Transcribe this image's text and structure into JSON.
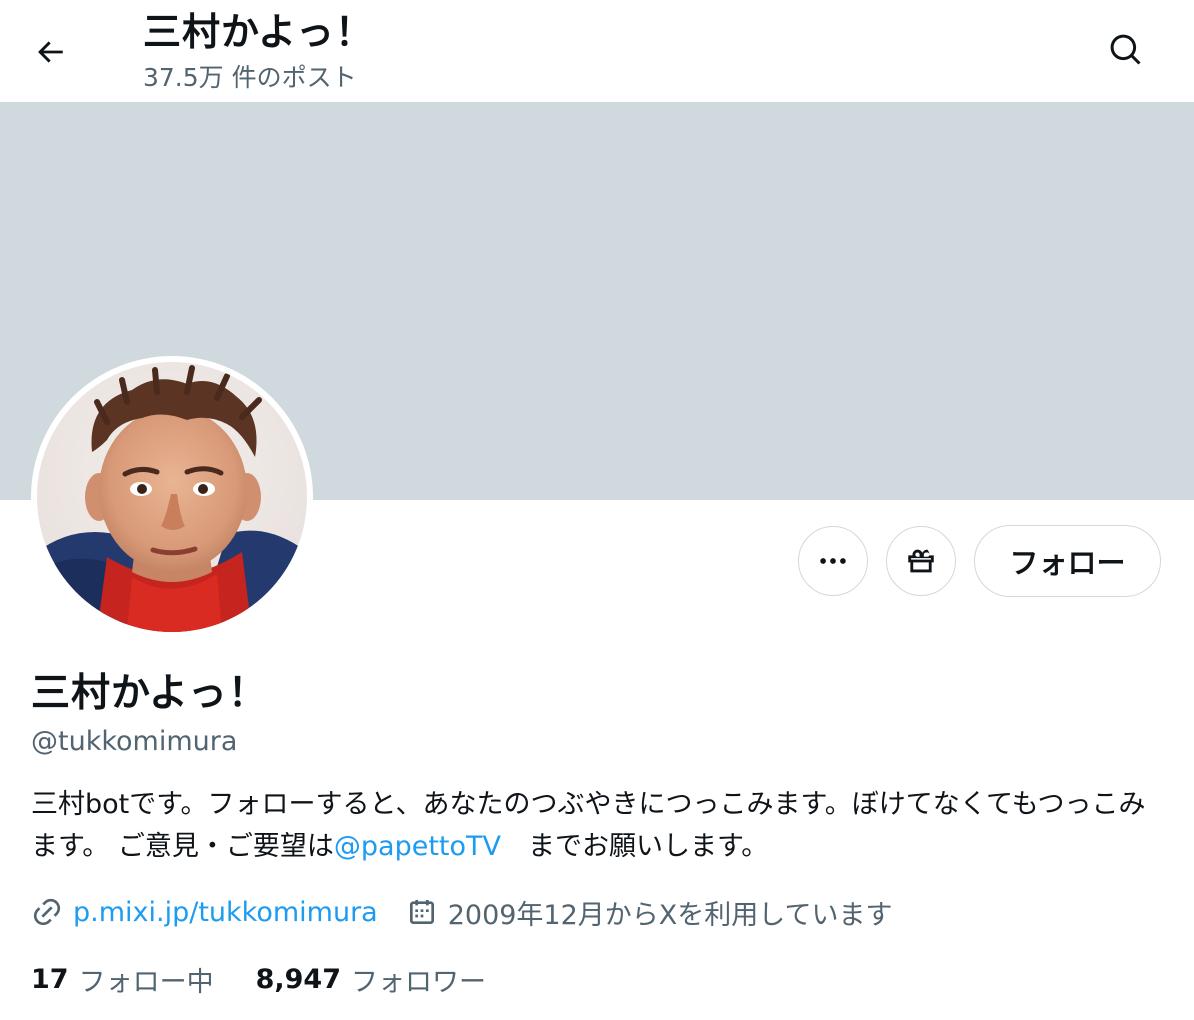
{
  "header": {
    "title": "三村かよっ！",
    "post_count": "37.5万 件のポスト",
    "back_icon": "arrow-left-icon",
    "search_icon": "search-icon"
  },
  "colors": {
    "banner": "#cfd9de",
    "link": "#1d9bf0",
    "secondary_text": "#536471",
    "primary_text": "#0f1419"
  },
  "actions": {
    "more_icon": "more-dots-icon",
    "gift_icon": "gift-icon",
    "follow_label": "フォロー"
  },
  "profile": {
    "name": "三村かよっ！",
    "handle": "@tukkomimura",
    "bio_before": "三村botです。フォローすると、あなたのつぶやきにつっこみます。ぼけてなくてもつっこみます。 ご意見・ご要望は",
    "bio_mention": "@papettoTV",
    "bio_after": "　までお願いします。",
    "link": "p.mixi.jp/tukkomimura",
    "joined": "2009年12月からXを利用しています",
    "following_count": "17",
    "following_label": "フォロー中",
    "followers_count": "8,947",
    "followers_label": "フォロワー"
  }
}
